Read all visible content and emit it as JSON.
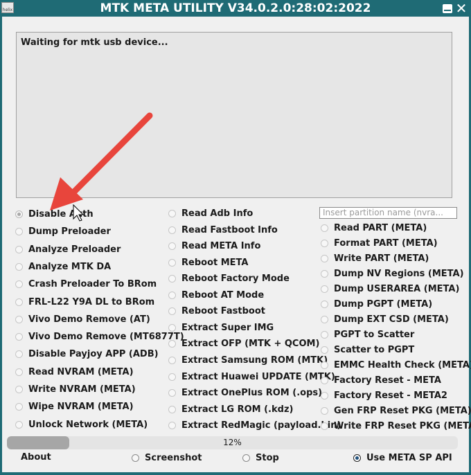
{
  "window": {
    "title": "MTK META UTILITY V34.0.2.0:28:02:2022",
    "icon_text": "helix"
  },
  "log": {
    "text": "Waiting for mtk usb device..."
  },
  "partition_input": {
    "placeholder": "Insert partition name (nvra..."
  },
  "column1": [
    {
      "label": "Disable Auth",
      "selected": true
    },
    {
      "label": "Dump Preloader",
      "selected": false
    },
    {
      "label": "Analyze Preloader",
      "selected": false
    },
    {
      "label": "Analyze MTK DA",
      "selected": false
    },
    {
      "label": "Crash Preloader To BRom",
      "selected": false
    },
    {
      "label": "FRL-L22 Y9A DL to BRom",
      "selected": false
    },
    {
      "label": "Vivo Demo Remove (AT)",
      "selected": false
    },
    {
      "label": "Vivo Demo Remove (MT6877T)",
      "selected": false
    },
    {
      "label": "Disable Payjoy APP (ADB)",
      "selected": false
    },
    {
      "label": "Read NVRAM (META)",
      "selected": false
    },
    {
      "label": "Write NVRAM (META)",
      "selected": false
    },
    {
      "label": "Wipe NVRAM (META)",
      "selected": false
    },
    {
      "label": "Unlock Network (META)",
      "selected": false
    }
  ],
  "column2": [
    {
      "label": "Read Adb Info"
    },
    {
      "label": "Read Fastboot Info"
    },
    {
      "label": "Read META Info"
    },
    {
      "label": "Reboot META"
    },
    {
      "label": "Reboot Factory Mode"
    },
    {
      "label": "Reboot AT Mode"
    },
    {
      "label": "Reboot Fastboot"
    },
    {
      "label": "Extract Super IMG"
    },
    {
      "label": "Extract OFP (MTK + QCOM)"
    },
    {
      "label": "Extract Samsung ROM (MTK)"
    },
    {
      "label": "Extract Huawei UPDATE (MTK)"
    },
    {
      "label": "Extract OnePlus ROM (.ops)"
    },
    {
      "label": "Extract LG ROM (.kdz)"
    },
    {
      "label": "Extract RedMagic (payload.bin)"
    }
  ],
  "column3": [
    {
      "label": "Read PART (META)"
    },
    {
      "label": "Format PART (META)"
    },
    {
      "label": "Write PART (META)"
    },
    {
      "label": "Dump NV Regions (META)"
    },
    {
      "label": "Dump USERAREA (META)"
    },
    {
      "label": "Dump PGPT (META)"
    },
    {
      "label": "Dump  EXT CSD (META)"
    },
    {
      "label": "PGPT to Scatter"
    },
    {
      "label": "Scatter to PGPT"
    },
    {
      "label": "EMMC Health Check (META)"
    },
    {
      "label": "Factory Reset - META"
    },
    {
      "label": "Factory Reset - META2"
    },
    {
      "label": "Gen FRP Reset PKG (META)"
    },
    {
      "label": "Write FRP Reset PKG (META)"
    }
  ],
  "progress": {
    "value": 12,
    "text": "12%"
  },
  "bottom": {
    "about_label": "About",
    "screenshot_label": "Screenshot",
    "stop_label": "Stop",
    "use_meta_sp_api_label": "Use META SP API",
    "use_meta_sp_api_checked": true
  },
  "colors": {
    "title_bar": "#1f6b75",
    "annotation_arrow": "#e8453c"
  },
  "icons": [
    "minimize-icon",
    "close-icon",
    "app-icon",
    "red-arrow-annotation",
    "mouse-cursor-icon"
  ]
}
